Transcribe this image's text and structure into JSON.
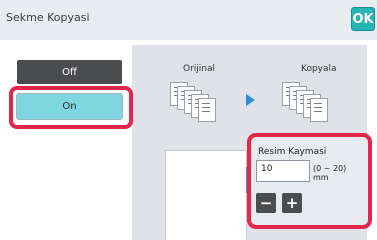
{
  "header": {
    "title": "Sekme Kopyasi",
    "ok_label": "OK"
  },
  "mode": {
    "off_label": "Off",
    "on_label": "On",
    "selected": "On"
  },
  "preview": {
    "original_label": "Orijinal",
    "copy_label": "Kopyala"
  },
  "image_shift": {
    "title": "Resim Kaymasi",
    "value": "10",
    "range_text": "(0 ~ 20)",
    "unit": "mm",
    "minus_symbol": "−",
    "plus_symbol": "+"
  },
  "colors": {
    "accent": "#26b5b4",
    "highlight": "#e4264a",
    "selected_button": "#7fd6e0",
    "dark_button": "#4b4c4e",
    "arrow": "#2d8fd5"
  },
  "icons": {
    "arrow": "play-arrow-icon",
    "shift": "image-shift-icon"
  }
}
